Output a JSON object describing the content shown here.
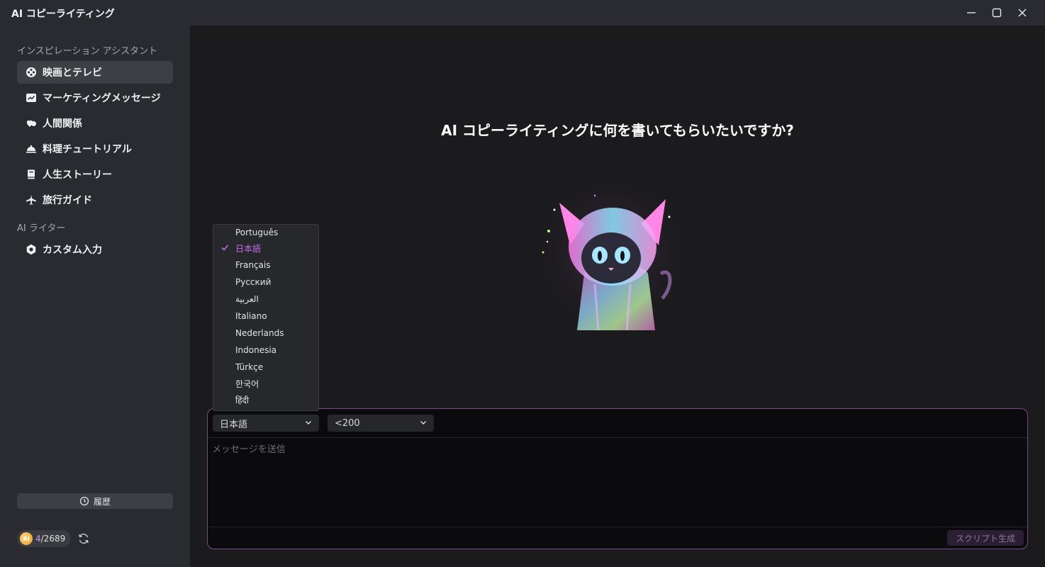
{
  "window": {
    "title": "AI コピーライティング"
  },
  "sidebar": {
    "section_inspiration": "インスピレーション アシスタント",
    "section_writer": "AI ライター",
    "items": [
      {
        "label": "映画とテレビ",
        "icon": "film-reel-icon"
      },
      {
        "label": "マーケティングメッセージ",
        "icon": "chart-trend-icon"
      },
      {
        "label": "人間関係",
        "icon": "hearts-icon"
      },
      {
        "label": "料理チュートリアル",
        "icon": "serving-dish-icon"
      },
      {
        "label": "人生ストーリー",
        "icon": "book-icon"
      },
      {
        "label": "旅行ガイド",
        "icon": "airplane-icon"
      }
    ],
    "writer_items": [
      {
        "label": "カスタム入力",
        "icon": "gear-icon"
      }
    ],
    "history_label": "履歴",
    "credits": {
      "coin_label": "AI",
      "used": "4",
      "total": "/2689"
    }
  },
  "main": {
    "headline": "AI コピーライティングに何を書いてもらいたいですか?"
  },
  "composer": {
    "language_value": "日本語",
    "length_value": "<200",
    "placeholder": "メッセージを送信",
    "generate_label": "スクリプト生成"
  },
  "language_dropdown": {
    "options": [
      "Português",
      "日本語",
      "Français",
      "Русский",
      "العربية",
      "Italiano",
      "Nederlands",
      "Indonesia",
      "Türkçe",
      "한국어",
      "हिंदी"
    ],
    "selected": "日本語"
  },
  "colors": {
    "accent": "#c66fe8",
    "sidebar_bg": "#2a2b30",
    "main_bg": "#1b1b1d",
    "composer_border": "#7a4a8e"
  }
}
